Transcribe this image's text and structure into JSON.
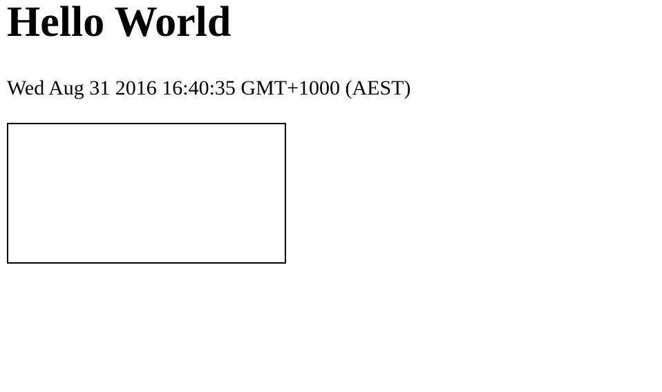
{
  "page": {
    "title": "Hello World",
    "timestamp": "Wed Aug 31 2016 16:40:35 GMT+1000 (AEST)"
  },
  "colors": {
    "background": "#ffffff",
    "text": "#000000",
    "box_border": "#000000"
  }
}
